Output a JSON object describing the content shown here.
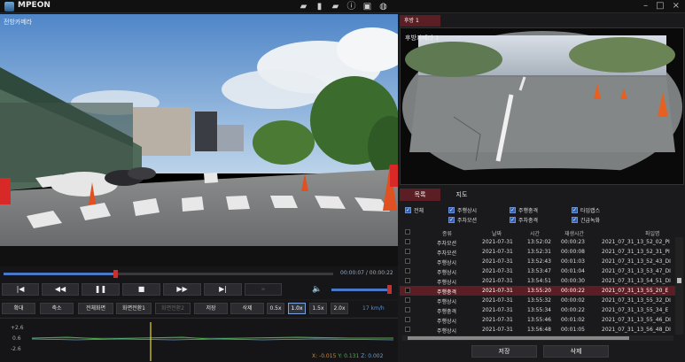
{
  "app": {
    "name": "MPEON"
  },
  "toolbar_icons": [
    "folder-icon",
    "sd-card-icon",
    "folder-settings-icon",
    "info-icon",
    "display-icon",
    "globe-icon"
  ],
  "front": {
    "label": "전방카메라"
  },
  "rear": {
    "tab_label": "후방 1",
    "label": "후방카메라 1"
  },
  "playback": {
    "time_current": "00:00:07",
    "time_total": "00:00:22",
    "time_text": "00:00:07 / 00:00:22",
    "progress_fraction": 0.34,
    "volume_fraction": 0.95
  },
  "controls": {
    "prev_file": "|◀",
    "rewind": "◀◀",
    "pause": "❚❚",
    "stop": "■",
    "forward": "▶▶",
    "next_file": "▶|",
    "skip": "»"
  },
  "tools": {
    "zoom_in": "확대",
    "zoom_out": "축소",
    "fullscreen": "전체화면",
    "screen_switch1": "화면전환1",
    "screen_switch2": "화면전환2",
    "save": "저장",
    "delete": "삭제",
    "speeds": [
      "0.5x",
      "1.0x",
      "1.5x",
      "2.0x"
    ],
    "active_speed": "1.0x",
    "speed_readout": "17 km/h"
  },
  "gsensor": {
    "y_labels": [
      "+2.6",
      "0.6",
      "-2.6"
    ],
    "x": "X: -0.015",
    "y": "Y: 0.131",
    "z": "Z: 0.002"
  },
  "list": {
    "tabs": [
      "목록",
      "지도"
    ],
    "filters": [
      "전체",
      "주행상시",
      "주행충격",
      "타임랩스",
      "주차모션",
      "주차충격",
      "긴급녹화"
    ],
    "headers": [
      "종류",
      "날짜",
      "시간",
      "재생시간",
      "파일명"
    ],
    "rows": [
      [
        "주차모션",
        "2021-07-31",
        "13:52:02",
        "00:00:23",
        "2021_07_31_13_52_02_PI"
      ],
      [
        "주차모션",
        "2021-07-31",
        "13:52:31",
        "00:00:08",
        "2021_07_31_13_52_31_PI"
      ],
      [
        "주행상시",
        "2021-07-31",
        "13:52:43",
        "00:01:03",
        "2021_07_31_13_52_43_DI"
      ],
      [
        "주행상시",
        "2021-07-31",
        "13:53:47",
        "00:01:04",
        "2021_07_31_13_53_47_DI"
      ],
      [
        "주행상시",
        "2021-07-31",
        "13:54:51",
        "00:00:30",
        "2021_07_31_13_54_51_DI"
      ],
      [
        "주행충격",
        "2021-07-31",
        "13:55:20",
        "00:00:22",
        "2021_07_31_13_55_20_E"
      ],
      [
        "주행상시",
        "2021-07-31",
        "13:55:32",
        "00:00:02",
        "2021_07_31_13_55_32_DI"
      ],
      [
        "주행충격",
        "2021-07-31",
        "13:55:34",
        "00:00:22",
        "2021_07_31_13_55_34_E"
      ],
      [
        "주행상시",
        "2021-07-31",
        "13:55:46",
        "00:01:02",
        "2021_07_31_13_55_46_DI"
      ],
      [
        "주행상시",
        "2021-07-31",
        "13:56:48",
        "00:01:05",
        "2021_07_31_13_56_48_DI"
      ]
    ],
    "selected_row": 5
  },
  "bottom": {
    "save": "저장",
    "delete": "삭제"
  },
  "colors": {
    "accent": "#5a1e24",
    "seek": "#4a78c8",
    "thumb": "#c83030"
  }
}
